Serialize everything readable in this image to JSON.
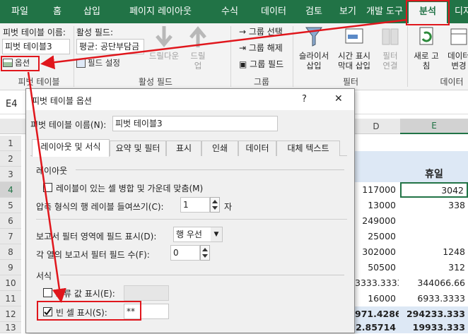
{
  "tabs": [
    "파일",
    "홈",
    "삽입",
    "페이지 레이아웃",
    "수식",
    "데이터",
    "검토",
    "보기",
    "개발 도구",
    "분석",
    "디자"
  ],
  "ribbon": {
    "pivot_name_label": "피벗 테이블 이름:",
    "pivot_name_value": "피벗 테이블3",
    "options_label": "옵션",
    "pivot_group": "피벗 테이블",
    "active_field_label": "활성 필드:",
    "active_field_value": "평균: 공단부담금",
    "field_settings": "필드 설정",
    "drilldown": "드릴다운",
    "drillup_1": "드릴",
    "drillup_2": "업",
    "active_field_group": "활성 필드",
    "group_selection": "그룹 선택",
    "ungroup": "그룹 해제",
    "group_field": "그룹 필드",
    "group_group": "그룹",
    "slicer_1": "슬라이서",
    "slicer_2": "삽입",
    "timeline_1": "시간 표시",
    "timeline_2": "막대 삽입",
    "filter_conn_1": "필터",
    "filter_conn_2": "연결",
    "filter_group": "필터",
    "refresh_1": "새로 고",
    "refresh_2": "침",
    "datasource_1": "데이터",
    "datasource_2": "변경",
    "data_group": "데이터"
  },
  "namebox": "E4",
  "sheet": {
    "col_d": "D",
    "col_e": "E",
    "rows": [
      "1",
      "2",
      "3",
      "4",
      "5",
      "6",
      "7",
      "8",
      "9",
      "10",
      "11",
      "12",
      "13"
    ],
    "header_e": "휴일",
    "d_values": [
      "117000",
      "13000",
      "249000",
      "25000",
      "302000",
      "50500",
      "3333.3333",
      "16000",
      "971.4286",
      "2.85714"
    ],
    "e_values": [
      "3042",
      "338",
      "",
      "",
      "1248",
      "312",
      "344066.66",
      "6933.3333",
      "294233.333",
      "19933.333"
    ]
  },
  "dialog": {
    "title": "피벗 테이블 옵션",
    "help": "?",
    "close": "✕",
    "name_label": "피벗 테이블 이름(N):",
    "name_value": "피벗 테이블3",
    "tabs": [
      "레이아웃 및 서식",
      "요약 및 필터",
      "표시",
      "인쇄",
      "데이터",
      "대체 텍스트"
    ],
    "layout_section": "레이아웃",
    "merge_label": "레이블이 있는 셀 병합 및 가운데 맞춤(M)",
    "indent_label": "압축 형식의 행 레이블 들여쓰기(C):",
    "indent_value": "1",
    "indent_unit": "자",
    "report_filter_label": "보고서 필터 영역에 필드 표시(D):",
    "report_filter_value": "행 우선",
    "fields_per_col_label": "각 열의 보고서 필터 필드 수(F):",
    "fields_per_col_value": "0",
    "format_section": "서식",
    "error_label": "오류 값 표시(E):",
    "empty_label": "빈 셀 표시(S):",
    "empty_value": "**"
  },
  "colors": {
    "ribbon_green": "#217346",
    "highlight_red": "#e0161c"
  }
}
